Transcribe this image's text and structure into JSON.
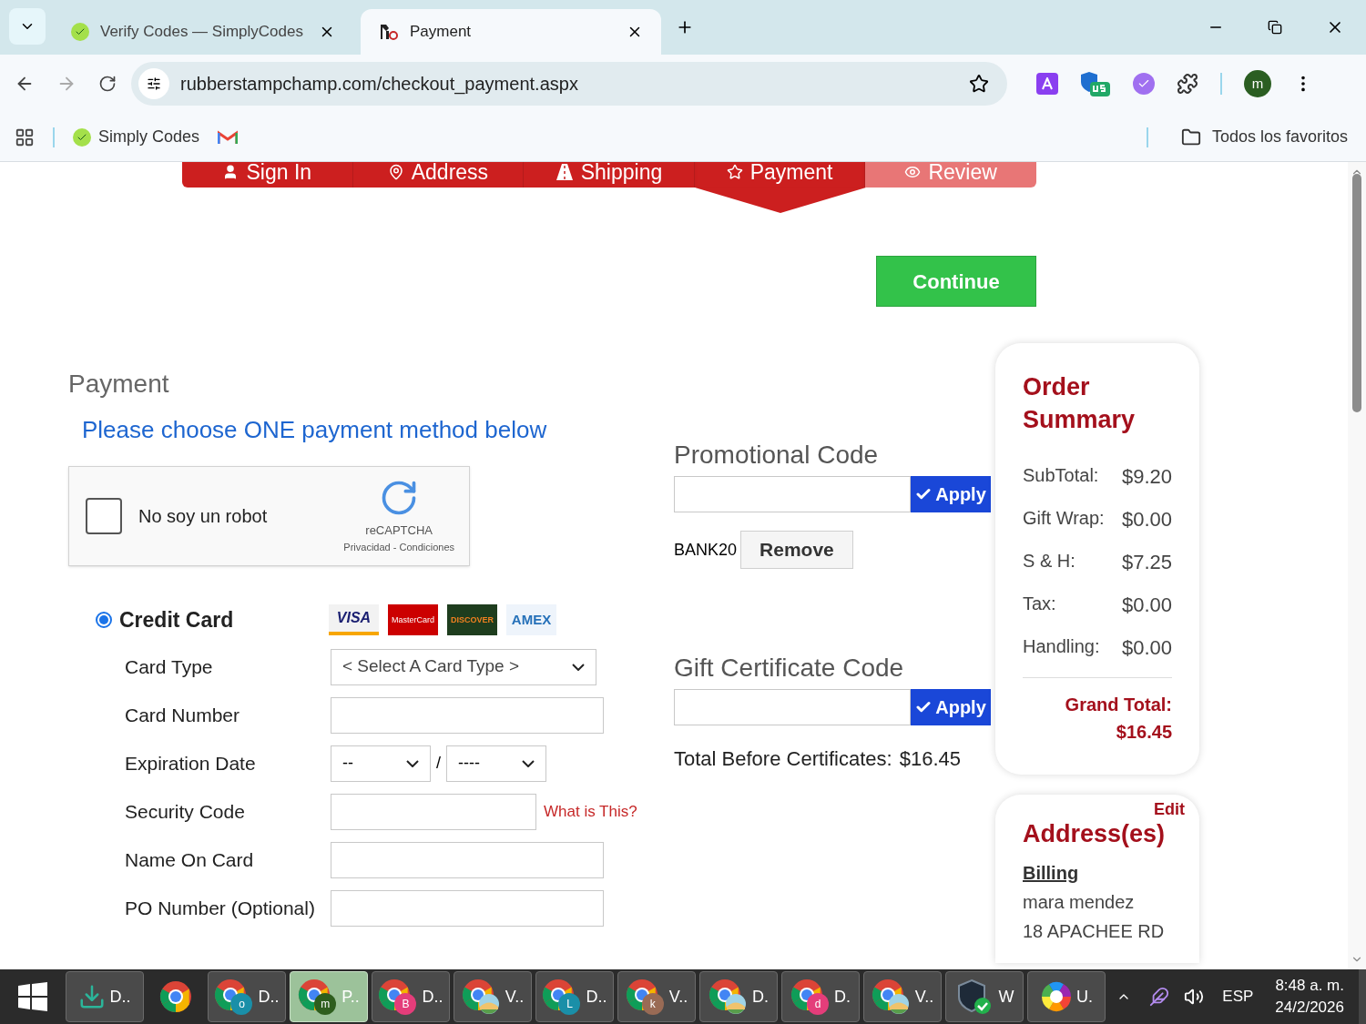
{
  "browser": {
    "tabs": [
      {
        "title": "Verify Codes — SimplyCodes",
        "selected": false,
        "kind": "simply"
      },
      {
        "title": "Payment",
        "selected": true,
        "kind": "rsc"
      }
    ],
    "url": "rubberstampchamp.com/checkout_payment.aspx",
    "profile": "m",
    "bookmarks": [
      {
        "label": "Simply Codes",
        "kind": "simply"
      },
      {
        "kind": "gmail"
      }
    ],
    "all_bookmarks": "Todos los favoritos"
  },
  "steps": [
    {
      "label": "Sign In",
      "selected": false,
      "disabled": false
    },
    {
      "label": "Address",
      "selected": false,
      "disabled": false
    },
    {
      "label": "Shipping",
      "selected": false,
      "disabled": false
    },
    {
      "label": "Payment",
      "selected": true,
      "disabled": false
    },
    {
      "label": "Review",
      "selected": false,
      "disabled": true
    }
  ],
  "continue_button": "Continue",
  "payment": {
    "heading": "Payment",
    "subtitle": "Please choose ONE payment method below",
    "captcha": {
      "checked": false,
      "label": "No soy un robot",
      "brand": "reCAPTCHA",
      "links": "Privacidad - Condiciones"
    },
    "method": {
      "label": "Credit Card",
      "selected": true,
      "logos": [
        "VISA",
        "MasterCard",
        "DISCOVER",
        "AMEX"
      ]
    },
    "fields": [
      {
        "label": "Card Type",
        "kind": "select",
        "value": "< Select A Card Type >"
      },
      {
        "label": "Card Number",
        "kind": "text"
      },
      {
        "label": "Expiration Date",
        "kind": "expiry",
        "month": "--",
        "separator": "/",
        "year": "----"
      },
      {
        "label": "Security Code",
        "kind": "text",
        "link": "What is This?"
      },
      {
        "label": "Name On Card",
        "kind": "text"
      },
      {
        "label": "PO Number (Optional)",
        "kind": "text"
      }
    ]
  },
  "promo": {
    "title": "Promotional Code",
    "apply": "Apply",
    "applied_code": "BANK20",
    "remove": "Remove"
  },
  "gift": {
    "title": "Gift Certificate Code",
    "apply": "Apply",
    "total_label": "Total Before Certificates:",
    "total_value": "$16.45"
  },
  "summary": {
    "title": "Order Summary",
    "rows": [
      {
        "label": "SubTotal:",
        "value": "$9.20"
      },
      {
        "label": "Gift Wrap:",
        "value": "$0.00"
      },
      {
        "label": "S & H:",
        "value": "$7.25"
      },
      {
        "label": "Tax:",
        "value": "$0.00"
      },
      {
        "label": "Handling:",
        "value": "$0.00"
      }
    ],
    "grand_label": "Grand Total:",
    "grand_value": "$16.45"
  },
  "addresses": {
    "edit": "Edit",
    "title": "Address(es)",
    "billing": "Billing",
    "lines": [
      "mara mendez",
      "18 APACHEE RD"
    ]
  },
  "taskbar": {
    "items": [
      {
        "kind": "download",
        "label": "D..",
        "selected": false
      },
      {
        "kind": "chrome",
        "selected": false
      },
      {
        "kind": "chrome",
        "badge": "o",
        "color": "#1a8fa8",
        "label": "D..",
        "selected": false
      },
      {
        "kind": "chrome",
        "badge": "m",
        "color": "#2e5e1e",
        "label": "P..",
        "selected": true
      },
      {
        "kind": "chrome",
        "badge": "B",
        "color": "#e43d7a",
        "label": "D..",
        "selected": false
      },
      {
        "kind": "chrome-pic",
        "label": "V..",
        "selected": false
      },
      {
        "kind": "chrome",
        "badge": "L",
        "color": "#1a8fa8",
        "label": "D..",
        "selected": false
      },
      {
        "kind": "chrome",
        "badge": "k",
        "color": "#9a6b55",
        "label": "V..",
        "selected": false
      },
      {
        "kind": "chrome-pic",
        "label": "D.",
        "selected": false
      },
      {
        "kind": "chrome",
        "badge": "d",
        "color": "#e43d7a",
        "label": "D.",
        "selected": false
      },
      {
        "kind": "chrome-pic",
        "label": "V..",
        "selected": false
      },
      {
        "kind": "shield",
        "label": "W",
        "selected": false
      },
      {
        "kind": "wheel",
        "label": "U.",
        "selected": false
      }
    ],
    "language": "ESP",
    "time": "8:48 a. m.",
    "date": "24/2/2026"
  }
}
